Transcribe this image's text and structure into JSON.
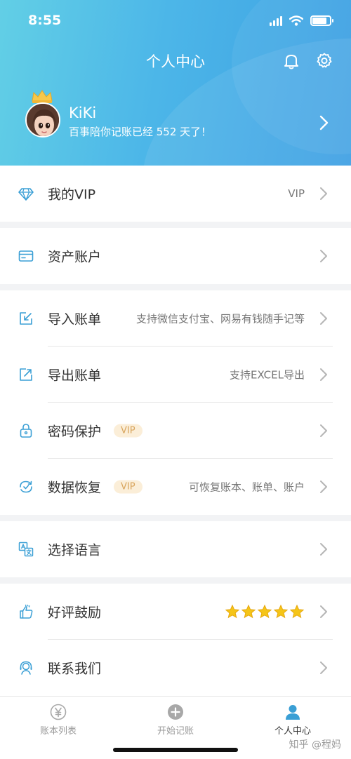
{
  "status_bar": {
    "time": "8:55"
  },
  "header": {
    "title": "个人中心"
  },
  "profile": {
    "name": "KiKi",
    "subtitle": "百事陪你记账已经 552 天了！"
  },
  "menu": {
    "vip": {
      "label": "我的VIP",
      "value": "VIP"
    },
    "assets": {
      "label": "资产账户"
    },
    "import": {
      "label": "导入账单",
      "value": "支持微信支付宝、网易有钱随手记等"
    },
    "export": {
      "label": "导出账单",
      "value": "支持EXCEL导出"
    },
    "password": {
      "label": "密码保护",
      "tag": "VIP"
    },
    "recovery": {
      "label": "数据恢复",
      "tag": "VIP",
      "value": "可恢复账本、账单、账户"
    },
    "language": {
      "label": "选择语言"
    },
    "rating": {
      "label": "好评鼓励",
      "stars": 5
    },
    "contact": {
      "label": "联系我们"
    }
  },
  "tabbar": {
    "tabs": [
      {
        "label": "账本列表",
        "icon": "yen-circle-icon",
        "active": false
      },
      {
        "label": "开始记账",
        "icon": "plus-circle-icon",
        "active": false
      },
      {
        "label": "个人中心",
        "icon": "person-icon",
        "active": true
      }
    ]
  },
  "watermark": "知乎 @程妈",
  "colors": {
    "accent": "#4cb6e8",
    "icon": "#3a9fd5",
    "vip_tag_bg": "#fbeed8",
    "vip_tag_text": "#d8a45c",
    "star": "#f5c518"
  }
}
